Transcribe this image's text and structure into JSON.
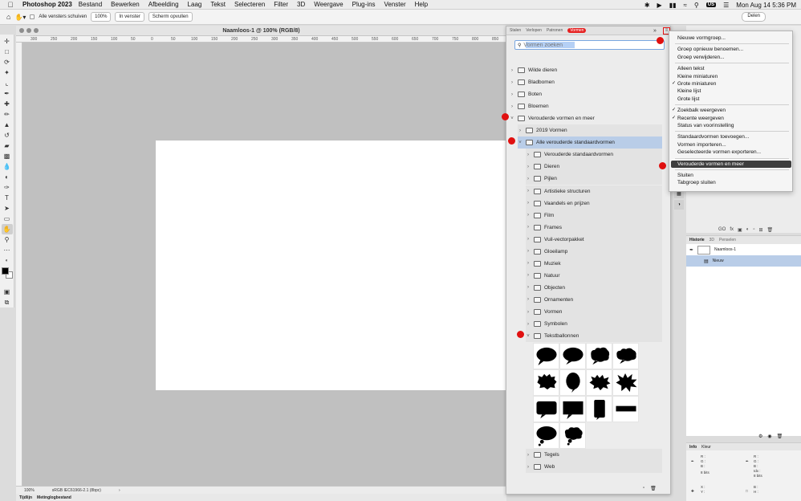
{
  "menubar": {
    "app": "Photoshop 2023",
    "items": [
      "Bestand",
      "Bewerken",
      "Afbeelding",
      "Laag",
      "Tekst",
      "Selecteren",
      "Filter",
      "3D",
      "Weergave",
      "Plug-ins",
      "Venster",
      "Help"
    ],
    "keyboard": "US",
    "datetime": "Mon Aug 14  5:36 PM"
  },
  "options": {
    "scroll_all": "Alle vensters schuiven",
    "zoom": "100%",
    "fit_window": "In venster",
    "fill_screen": "Scherm opvullen",
    "share": "Delen"
  },
  "document": {
    "title": "Naamloos-1 @ 100% (RGB/8)",
    "ruler_ticks": [
      "300",
      "250",
      "200",
      "150",
      "100",
      "50",
      "0",
      "50",
      "100",
      "150",
      "200",
      "250",
      "300",
      "350",
      "400",
      "450",
      "500",
      "550",
      "600",
      "650",
      "700",
      "750",
      "800",
      "850"
    ],
    "status_zoom": "100%",
    "status_profile": "sRGB IEC61966-2.1 (8bpc)",
    "canvas_color": "#ffffff"
  },
  "bottom_tabs": [
    "Tijdlijn",
    "Metinglogbestand"
  ],
  "shapes_panel": {
    "tabs": [
      "Stalen",
      "Verlopen",
      "Patronen",
      "Vormen"
    ],
    "active_tab": "Vormen",
    "search_placeholder": "Vormen zoeken",
    "rows": [
      {
        "label": "Wilde dieren",
        "level": 0,
        "open": false
      },
      {
        "label": "Bladbomen",
        "level": 0,
        "open": false
      },
      {
        "label": "Boten",
        "level": 0,
        "open": false
      },
      {
        "label": "Bloemen",
        "level": 0,
        "open": false
      },
      {
        "label": "Verouderde vormen en meer",
        "level": 0,
        "open": true
      },
      {
        "label": "2019 Vormen",
        "level": 1,
        "open": false
      },
      {
        "label": "Alle verouderde standaardvormen",
        "level": 1,
        "open": true,
        "selected": true
      },
      {
        "label": "Verouderde standaardvormen",
        "level": 2,
        "open": false
      },
      {
        "label": "Dieren",
        "level": 2,
        "open": false
      },
      {
        "label": "Pijlen",
        "level": 2,
        "open": false
      },
      {
        "label": "Artistieke structuren",
        "level": 2,
        "open": false
      },
      {
        "label": "Vaandels en prijzen",
        "level": 2,
        "open": false
      },
      {
        "label": "Film",
        "level": 2,
        "open": false
      },
      {
        "label": "Frames",
        "level": 2,
        "open": false
      },
      {
        "label": "Vuil-vectorpakket",
        "level": 2,
        "open": false
      },
      {
        "label": "Gloeilamp",
        "level": 2,
        "open": false
      },
      {
        "label": "Muziek",
        "level": 2,
        "open": false
      },
      {
        "label": "Natuur",
        "level": 2,
        "open": false
      },
      {
        "label": "Objecten",
        "level": 2,
        "open": false
      },
      {
        "label": "Ornamenten",
        "level": 2,
        "open": false
      },
      {
        "label": "Vormen",
        "level": 2,
        "open": false
      },
      {
        "label": "Symbolen",
        "level": 2,
        "open": false
      },
      {
        "label": "Tekstballonnen",
        "level": 2,
        "open": true
      }
    ],
    "after_rows": [
      "Tegels",
      "Web"
    ],
    "accent": "#e01010"
  },
  "flyout_menu": {
    "items": [
      {
        "label": "Nieuwe vormgroep...",
        "checked": false
      },
      {
        "sep": true
      },
      {
        "label": "Groep opnieuw benoemen...",
        "checked": false
      },
      {
        "label": "Groep verwijderen...",
        "checked": false
      },
      {
        "sep": true
      },
      {
        "label": "Alleen tekst",
        "checked": false
      },
      {
        "label": "Kleine miniaturen",
        "checked": false
      },
      {
        "label": "Grote miniaturen",
        "checked": true
      },
      {
        "label": "Kleine lijst",
        "checked": false
      },
      {
        "label": "Grote lijst",
        "checked": false
      },
      {
        "sep": true
      },
      {
        "label": "Zoekbalk weergeven",
        "checked": true
      },
      {
        "label": "Recente weergeven",
        "checked": true
      },
      {
        "label": "Status van voorinstelling",
        "checked": false
      },
      {
        "sep": true
      },
      {
        "label": "Standaardvormen toevoegen...",
        "checked": false
      },
      {
        "label": "Vormen importeren...",
        "checked": false
      },
      {
        "label": "Geselecteerde vormen exporteren...",
        "checked": false
      },
      {
        "sep": true
      },
      {
        "label": "Verouderde vormen en meer",
        "checked": false,
        "highlighted": true
      },
      {
        "sep": true
      },
      {
        "label": "Sluiten",
        "checked": false
      },
      {
        "label": "Tabgroep sluiten",
        "checked": false
      }
    ]
  },
  "history_panel": {
    "tabs": [
      "Historie",
      "3D",
      "Penselen"
    ],
    "active_tab": "Historie",
    "snapshot": "Naamloos-1",
    "entries": [
      "Nieuw"
    ]
  },
  "info_panel": {
    "tabs": [
      "Info",
      "Kleur"
    ],
    "active_tab": "Info",
    "left_rgb": [
      "R :",
      "G :",
      "B :"
    ],
    "left_bits": "8 bits",
    "right_rgb": [
      "R :",
      "G :",
      "B :",
      "Idx :"
    ],
    "right_bits": "8 bits",
    "xy": [
      "X :",
      "Y :"
    ],
    "wh": [
      "B :",
      "H :"
    ]
  }
}
